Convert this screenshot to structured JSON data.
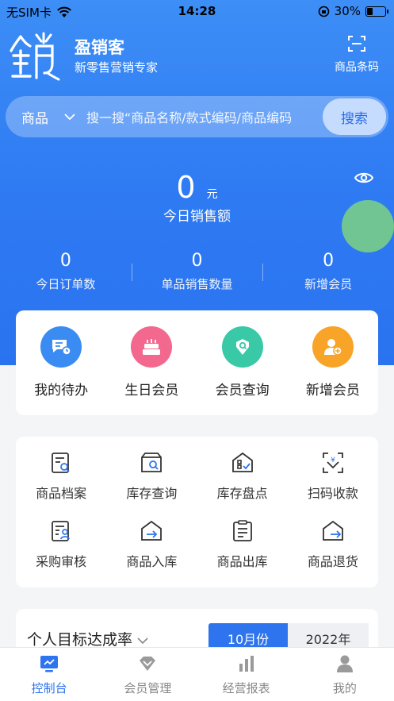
{
  "status_bar": {
    "carrier": "无SIM卡",
    "time": "14:28",
    "battery": "30%",
    "battery_level": 0.3
  },
  "header": {
    "title": "盈销客",
    "subtitle": "新零售营销专家",
    "barcode_label": "商品条码"
  },
  "search": {
    "category": "商品",
    "placeholder": "搜一搜“商品名称/款式编码/商品编码",
    "button": "搜索"
  },
  "sales": {
    "amount": "0",
    "unit": "元",
    "label": "今日销售额"
  },
  "stats": [
    {
      "value": "0",
      "label": "今日订单数"
    },
    {
      "value": "0",
      "label": "单品销售数量"
    },
    {
      "value": "0",
      "label": "新增会员"
    }
  ],
  "quick_actions": [
    {
      "label": "我的待办",
      "icon": "todo-icon",
      "color": "#3a8cf2"
    },
    {
      "label": "生日会员",
      "icon": "cake-icon",
      "color": "#f2688e"
    },
    {
      "label": "会员查询",
      "icon": "member-search-icon",
      "color": "#39c9a6"
    },
    {
      "label": "新增会员",
      "icon": "add-member-icon",
      "color": "#f7a428"
    }
  ],
  "tools": [
    {
      "label": "商品档案",
      "icon": "product-file-icon"
    },
    {
      "label": "库存查询",
      "icon": "inventory-query-icon"
    },
    {
      "label": "库存盘点",
      "icon": "stocktake-icon"
    },
    {
      "label": "扫码收款",
      "icon": "scan-pay-icon"
    },
    {
      "label": "采购审核",
      "icon": "purchase-review-icon"
    },
    {
      "label": "商品入库",
      "icon": "stock-in-icon"
    },
    {
      "label": "商品出库",
      "icon": "stock-out-icon"
    },
    {
      "label": "商品退货",
      "icon": "return-icon"
    }
  ],
  "target": {
    "title": "个人目标达成率",
    "month": "10月份",
    "year": "2022年"
  },
  "tabbar": [
    {
      "label": "控制台",
      "icon": "dashboard-icon",
      "active": true
    },
    {
      "label": "会员管理",
      "icon": "member-icon",
      "active": false
    },
    {
      "label": "经营报表",
      "icon": "report-icon",
      "active": false
    },
    {
      "label": "我的",
      "icon": "profile-icon",
      "active": false
    }
  ]
}
